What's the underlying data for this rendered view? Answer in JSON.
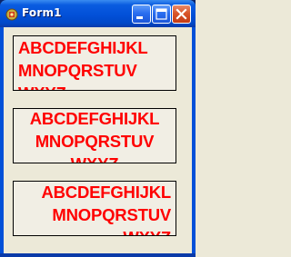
{
  "window": {
    "title": "Form1",
    "icon": "delphi-app-icon",
    "buttons": [
      "minimize-icon",
      "maximize-icon",
      "close-icon"
    ]
  },
  "textboxes": [
    {
      "align": "left",
      "text": "ABCDEFGHIJKL\nMNOPQRSTUV\nWXYZ"
    },
    {
      "align": "center",
      "text": "ABCDEFGHIJKL\nMNOPQRSTUV\nWXYZ"
    },
    {
      "align": "right",
      "text": "ABCDEFGHIJKL\nMNOPQRSTUV\nWXYZ"
    }
  ],
  "colors": {
    "text": "#ff0000",
    "titlebar": "#0250d8",
    "client": "#ece9d8"
  }
}
